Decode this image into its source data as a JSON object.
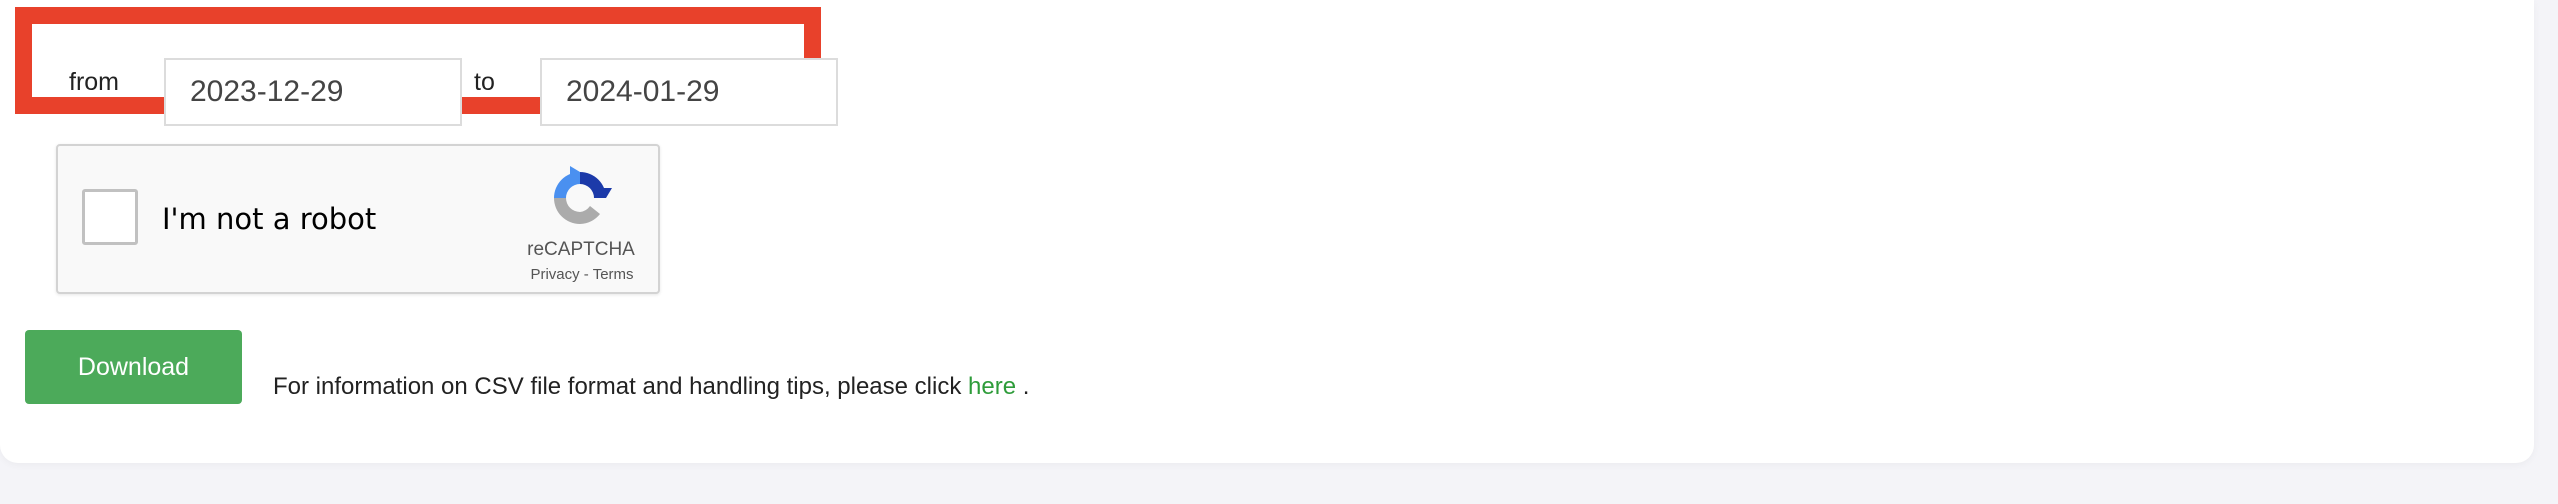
{
  "date_range": {
    "from_label": "from",
    "from_value": "2023-12-29",
    "to_label": "to",
    "to_value": "2024-01-29",
    "highlight_color": "#e8412b"
  },
  "recaptcha": {
    "checkbox_label": "I'm not a robot",
    "brand": "reCAPTCHA",
    "privacy_link": "Privacy",
    "separator": " - ",
    "terms_link": "Terms",
    "icon": "recaptcha-logo-icon"
  },
  "download": {
    "button_label": "Download",
    "button_color": "#4caa5a"
  },
  "info": {
    "text": "For information on CSV file format and handling tips, please click ",
    "link_text": "here",
    "trailing": " .",
    "link_color": "#2e9c3a"
  }
}
